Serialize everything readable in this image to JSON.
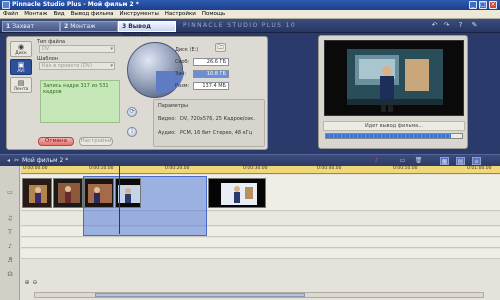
{
  "window": {
    "title": "Pinnacle Studio Plus - Мой фильм 2 *"
  },
  "menu": [
    "Файл",
    "Монтаж",
    "Вид",
    "Вывод фильма",
    "Инструменты",
    "Настройки",
    "Помощь"
  ],
  "steps": [
    {
      "num": "1",
      "label": "Захват",
      "active": false
    },
    {
      "num": "2",
      "label": "Монтаж",
      "active": false
    },
    {
      "num": "3",
      "label": "Вывод фильма",
      "active": true
    }
  ],
  "brand": "PINNACLE STUDIO PLUS 10",
  "side_tabs": [
    {
      "label": "Диск",
      "icon": "◉",
      "active": false
    },
    {
      "label": "AVI",
      "icon": "▣",
      "active": true
    },
    {
      "label": "Лента",
      "icon": "▤",
      "active": false
    }
  ],
  "left_panel": {
    "file_type_label": "Тип файла",
    "file_type_value": "DV",
    "template_label": "Шаблон",
    "template_value": "Как в проекте (DV)",
    "status": "Запись кадра 317 из 531 кадров",
    "cancel": "Отмена",
    "settings": "Настройки"
  },
  "disk": {
    "title": "Диск (E:)",
    "free_label": "Своб:",
    "free_value": "26.6 ГБ",
    "used_label": "Зан:",
    "used_value": "10.8 ГБ",
    "size_label": "Разм:",
    "size_value": "137.4 МБ"
  },
  "params": {
    "title": "Параметры",
    "video_label": "Видео:",
    "video_value": "DV, 720x576, 25 Кадров/сек.",
    "audio_label": "Аудио:",
    "audio_value": "PCM, 16 бит Стерео, 48 кГц"
  },
  "preview": {
    "progress_label": "Идет вывод фильма...",
    "progress": 0.92
  },
  "timeline": {
    "title": "Мой фильм 2 *",
    "ticks": [
      "0:00:00.00",
      "0:00:10.00",
      "0:00:20.00",
      "0:00:30.00",
      "0:00:40.00",
      "0:00:50.00",
      "0:01:00.00"
    ]
  },
  "colors": {
    "accent": "#2e4f9a",
    "selection": "#5880dc",
    "ruler": "#f0d878"
  }
}
